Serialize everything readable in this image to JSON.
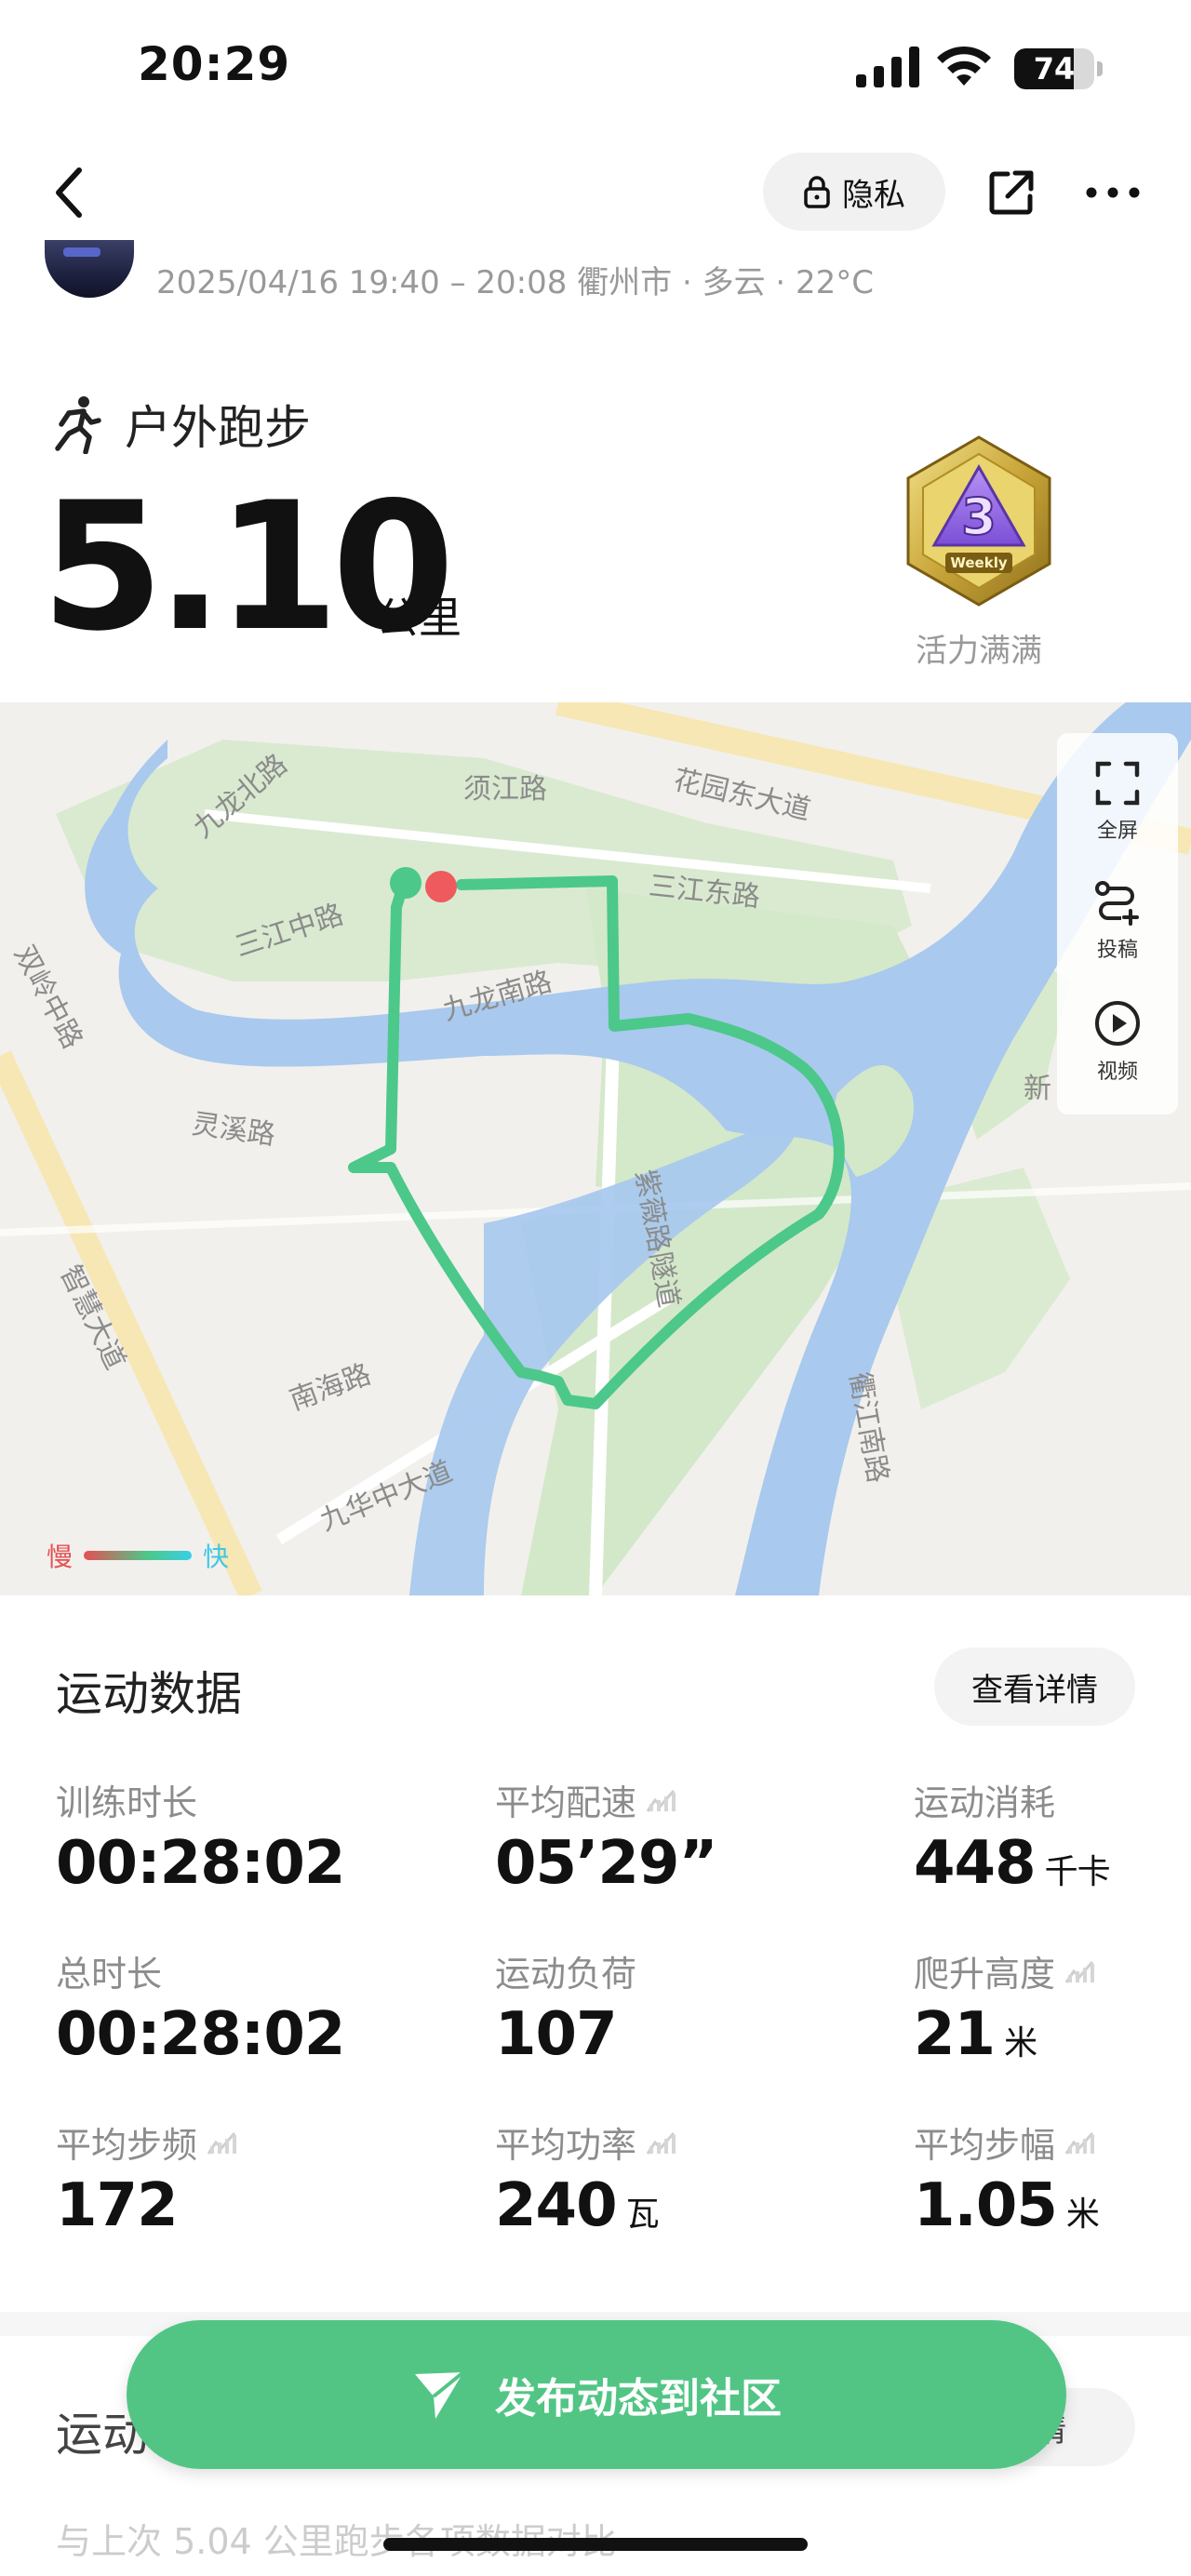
{
  "status_bar": {
    "time": "20:29",
    "battery": "74",
    "battery_level": 0.74
  },
  "nav": {
    "privacy_label": "隐私"
  },
  "meta": {
    "datetime": "2025/04/16 19:40 – 20:08",
    "location": "衢州市",
    "weather": "多云",
    "temperature": "22°C",
    "separator": "·"
  },
  "activity": {
    "type": "户外跑步",
    "distance": "5.10",
    "distance_unit": "公里",
    "badge_text": "Weekly",
    "badge_label": "活力满满"
  },
  "map": {
    "labels": {
      "xujiang": "须江路",
      "huayuan": "花园东大道",
      "jiulongbei": "九龙北路",
      "sanjiangzhong": "三江中路",
      "sanjiangdong": "三江东路",
      "jiulongnan": "九龙南路",
      "shuangling": "双岭中路",
      "lingxi": "灵溪路",
      "ziwei": "紫薇路隧道",
      "zhihui": "智慧大道",
      "nanhai": "南海路",
      "jiuhua": "九华中大道",
      "qujiangnan": "衢江南路",
      "xin": "新"
    },
    "tools": {
      "fullscreen": "全屏",
      "submit": "投稿",
      "video": "视频"
    },
    "legend": {
      "slow": "慢",
      "fast": "快"
    },
    "colors": {
      "route": "#4cc88a",
      "water": "#a9c9ee",
      "park": "#d8ebcf",
      "start": "#4cc88a",
      "end": "#ef5a5f"
    }
  },
  "stats": {
    "title": "运动数据",
    "detail": "查看详情",
    "items": [
      {
        "label": "训练时长",
        "value": "00:28:02",
        "unit": "",
        "chart_icon": false
      },
      {
        "label": "平均配速",
        "value": "05’29”",
        "unit": "",
        "chart_icon": true
      },
      {
        "label": "运动消耗",
        "value": "448",
        "unit": "千卡",
        "chart_icon": false
      },
      {
        "label": "总时长",
        "value": "00:28:02",
        "unit": "",
        "chart_icon": false
      },
      {
        "label": "运动负荷",
        "value": "107",
        "unit": "",
        "chart_icon": false
      },
      {
        "label": "爬升高度",
        "value": "21",
        "unit": "米",
        "chart_icon": true
      },
      {
        "label": "平均步频",
        "value": "172",
        "unit": "",
        "chart_icon": true
      },
      {
        "label": "平均功率",
        "value": "240",
        "unit": "瓦",
        "chart_icon": true
      },
      {
        "label": "平均步幅",
        "value": "1.05",
        "unit": "米",
        "chart_icon": true
      }
    ]
  },
  "section2": {
    "title": "运动",
    "detail": "详情",
    "subtitle": "与上次 5.04 公里跑步各项数据对比"
  },
  "publish": {
    "label": "发布动态到社区"
  }
}
